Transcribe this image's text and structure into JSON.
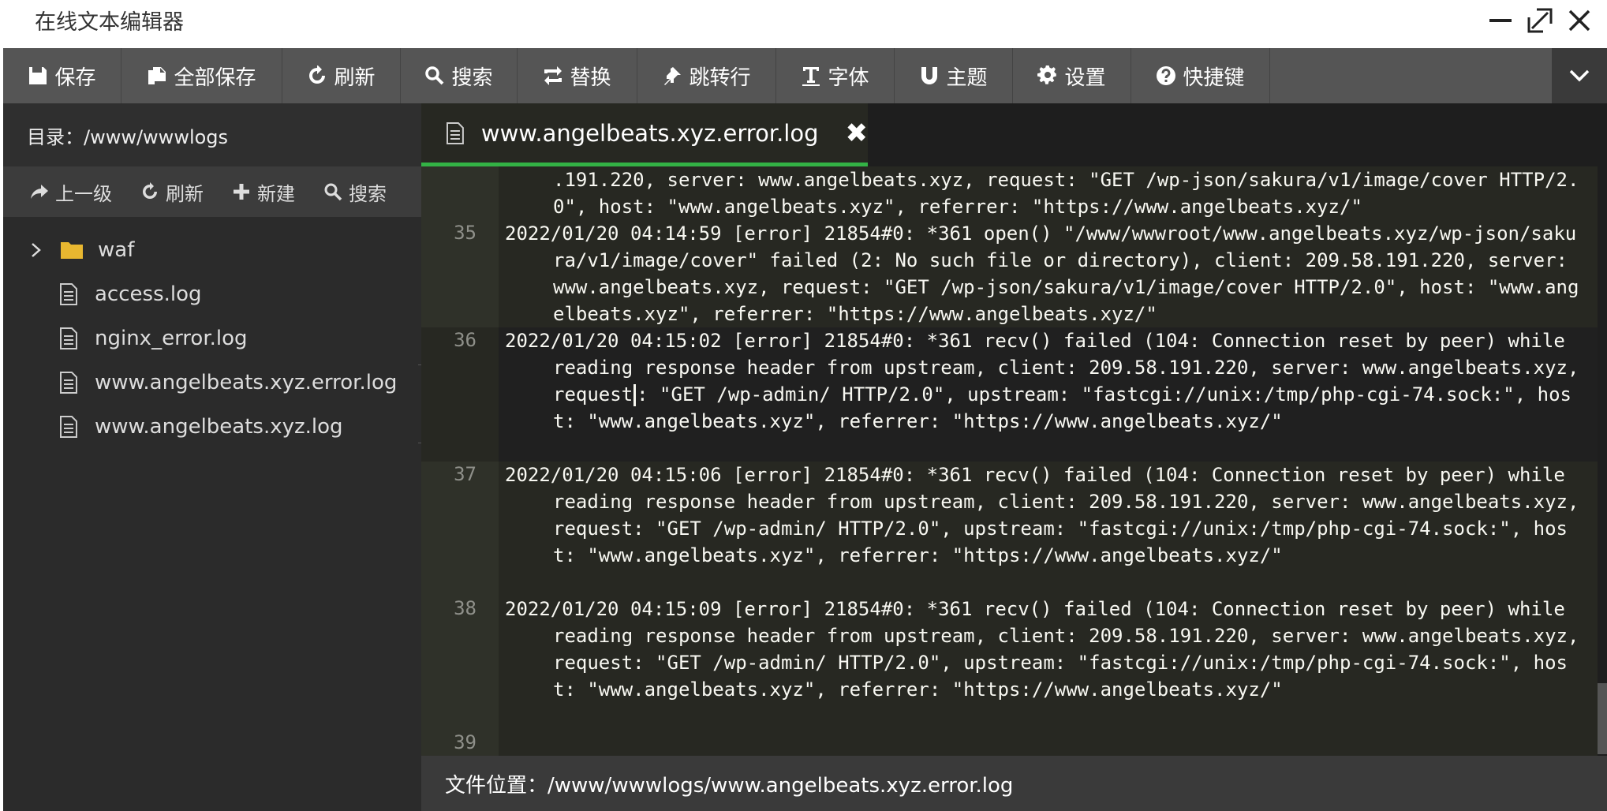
{
  "window": {
    "title": "在线文本编辑器",
    "controls": [
      "minimize-icon",
      "maximize-icon",
      "close-icon"
    ]
  },
  "toolbar": {
    "buttons": [
      {
        "label": "保存",
        "icon": "save-icon"
      },
      {
        "label": "全部保存",
        "icon": "save-all-icon"
      },
      {
        "label": "刷新",
        "icon": "refresh-icon"
      },
      {
        "label": "搜索",
        "icon": "search-icon"
      },
      {
        "label": "替换",
        "icon": "replace-icon"
      },
      {
        "label": "跳转行",
        "icon": "pin-icon"
      },
      {
        "label": "字体",
        "icon": "font-icon"
      },
      {
        "label": "主题",
        "icon": "magnet-icon"
      },
      {
        "label": "设置",
        "icon": "gear-icon"
      },
      {
        "label": "快捷键",
        "icon": "help-icon"
      }
    ]
  },
  "sidebar": {
    "directory_label": "目录：/www/wwwlogs",
    "actions": [
      {
        "label": "上一级",
        "icon": "share-arrow-icon"
      },
      {
        "label": "刷新",
        "icon": "refresh-icon"
      },
      {
        "label": "新建",
        "icon": "plus-icon"
      },
      {
        "label": "搜索",
        "icon": "search-icon"
      }
    ],
    "tree": [
      {
        "name": "waf",
        "type": "folder"
      },
      {
        "name": "access.log",
        "type": "file"
      },
      {
        "name": "nginx_error.log",
        "type": "file"
      },
      {
        "name": "www.angelbeats.xyz.error.log",
        "type": "file"
      },
      {
        "name": "www.angelbeats.xyz.log",
        "type": "file"
      }
    ]
  },
  "editor": {
    "tab_label": "www.angelbeats.xyz.error.log",
    "tab_close": "✖",
    "lines": [
      {
        "num": "",
        "text": ".191.220, server: www.angelbeats.xyz, request: \"GET /wp-json/sakura/v1/image/cover HTTP/2.0\", host: \"www.angelbeats.xyz\", referrer: \"https://www.angelbeats.xyz/\"",
        "continuation": true
      },
      {
        "num": "35",
        "text": "2022/01/20 04:14:59 [error] 21854#0: *361 open() \"/www/wwwroot/www.angelbeats.xyz/wp-json/sakura/v1/image/cover\" failed (2: No such file or directory), client: 209.58.191.220, server: www.angelbeats.xyz, request: \"GET /wp-json/sakura/v1/image/cover HTTP/2.0\", host: \"www.angelbeats.xyz\", referrer: \"https://www.angelbeats.xyz/\""
      },
      {
        "num": "36",
        "text_before_cursor": "2022/01/20 04:15:02 [error] 21854#0: *361 recv() failed (104: Connection reset by peer) while reading response header from upstream, client: 209.58.191.220, server: www.angelbeats.xyz, request",
        "text_after_cursor": ": \"GET /wp-admin/ HTTP/2.0\", upstream: \"fastcgi://unix:/tmp/php-cgi-74.sock:\", host: \"www.angelbeats.xyz\", referrer: \"https://www.angelbeats.xyz/\""
      },
      {
        "num": "37",
        "text": "2022/01/20 04:15:06 [error] 21854#0: *361 recv() failed (104: Connection reset by peer) while reading response header from upstream, client: 209.58.191.220, server: www.angelbeats.xyz, request: \"GET /wp-admin/ HTTP/2.0\", upstream: \"fastcgi://unix:/tmp/php-cgi-74.sock:\", host: \"www.angelbeats.xyz\", referrer: \"https://www.angelbeats.xyz/\""
      },
      {
        "num": "38",
        "text": "2022/01/20 04:15:09 [error] 21854#0: *361 recv() failed (104: Connection reset by peer) while reading response header from upstream, client: 209.58.191.220, server: www.angelbeats.xyz, request: \"GET /wp-admin/ HTTP/2.0\", upstream: \"fastcgi://unix:/tmp/php-cgi-74.sock:\", host: \"www.angelbeats.xyz\", referrer: \"https://www.angelbeats.xyz/\""
      },
      {
        "num": "39",
        "text": ""
      }
    ]
  },
  "status": {
    "file_location": "文件位置：/www/wwwlogs/www.angelbeats.xyz.error.log"
  },
  "colors": {
    "toolbar_bg": "#555555",
    "sidebar_bg": "#2b2b2b",
    "editor_bg": "#272822",
    "tab_accent": "#33b245",
    "folder": "#e8b730"
  }
}
